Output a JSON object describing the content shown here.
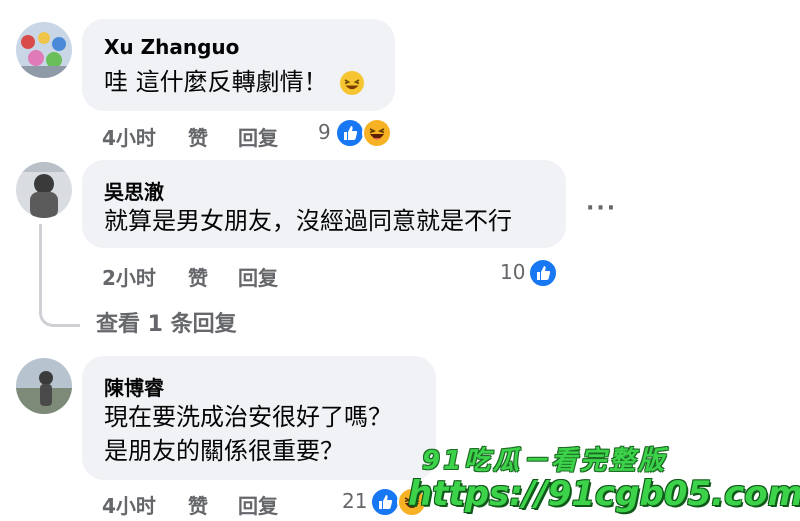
{
  "comments": [
    {
      "author": "Xu Zhanguo",
      "text": "哇 這什麼反轉劇情！",
      "time": "4小时",
      "like_label": "赞",
      "reply_label": "回复",
      "reaction_count": "9",
      "reactions": [
        "like-icon",
        "haha-icon"
      ]
    },
    {
      "author": "吳思澈",
      "text": "就算是男女朋友，沒經過同意就是不行",
      "time": "2小时",
      "like_label": "赞",
      "reply_label": "回复",
      "reaction_count": "10",
      "reactions": [
        "like-icon"
      ],
      "more_label": "···",
      "view_replies": "查看 1 条回复"
    },
    {
      "author": "陳博睿",
      "text_line1": "現在要洗成治安很好了嗎？",
      "text_line2": "是朋友的關係很重要？",
      "time": "4小时",
      "like_label": "赞",
      "reply_label": "回复",
      "reaction_count": "21",
      "reactions": [
        "like-icon",
        "haha-icon"
      ]
    }
  ],
  "watermark": {
    "line1": "91吃瓜－看完整版",
    "line2": "https://91cgb05.com"
  },
  "colors": {
    "bubble": "#f0f2f5",
    "meta_text": "#65676b",
    "like_blue": "#1877f2",
    "haha_yellow": "#f7b125",
    "watermark_green": "#3cd24a"
  }
}
